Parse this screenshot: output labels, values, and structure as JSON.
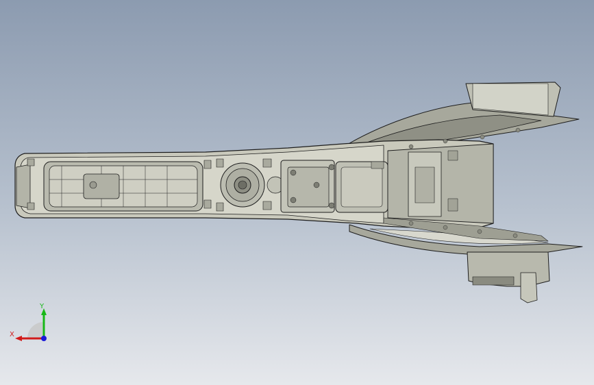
{
  "viewport": {
    "background_top": "#8c9bb0",
    "background_bottom": "#e6e8ec",
    "model_fill": "#c9c9bc",
    "model_shadow": "#9c9c90",
    "model_line": "#1c1c1c"
  },
  "triad": {
    "x_label": "X",
    "y_label": "Y",
    "x_color": "#d11a1a",
    "y_color": "#18b818",
    "z_color": "#1a1ad8"
  }
}
